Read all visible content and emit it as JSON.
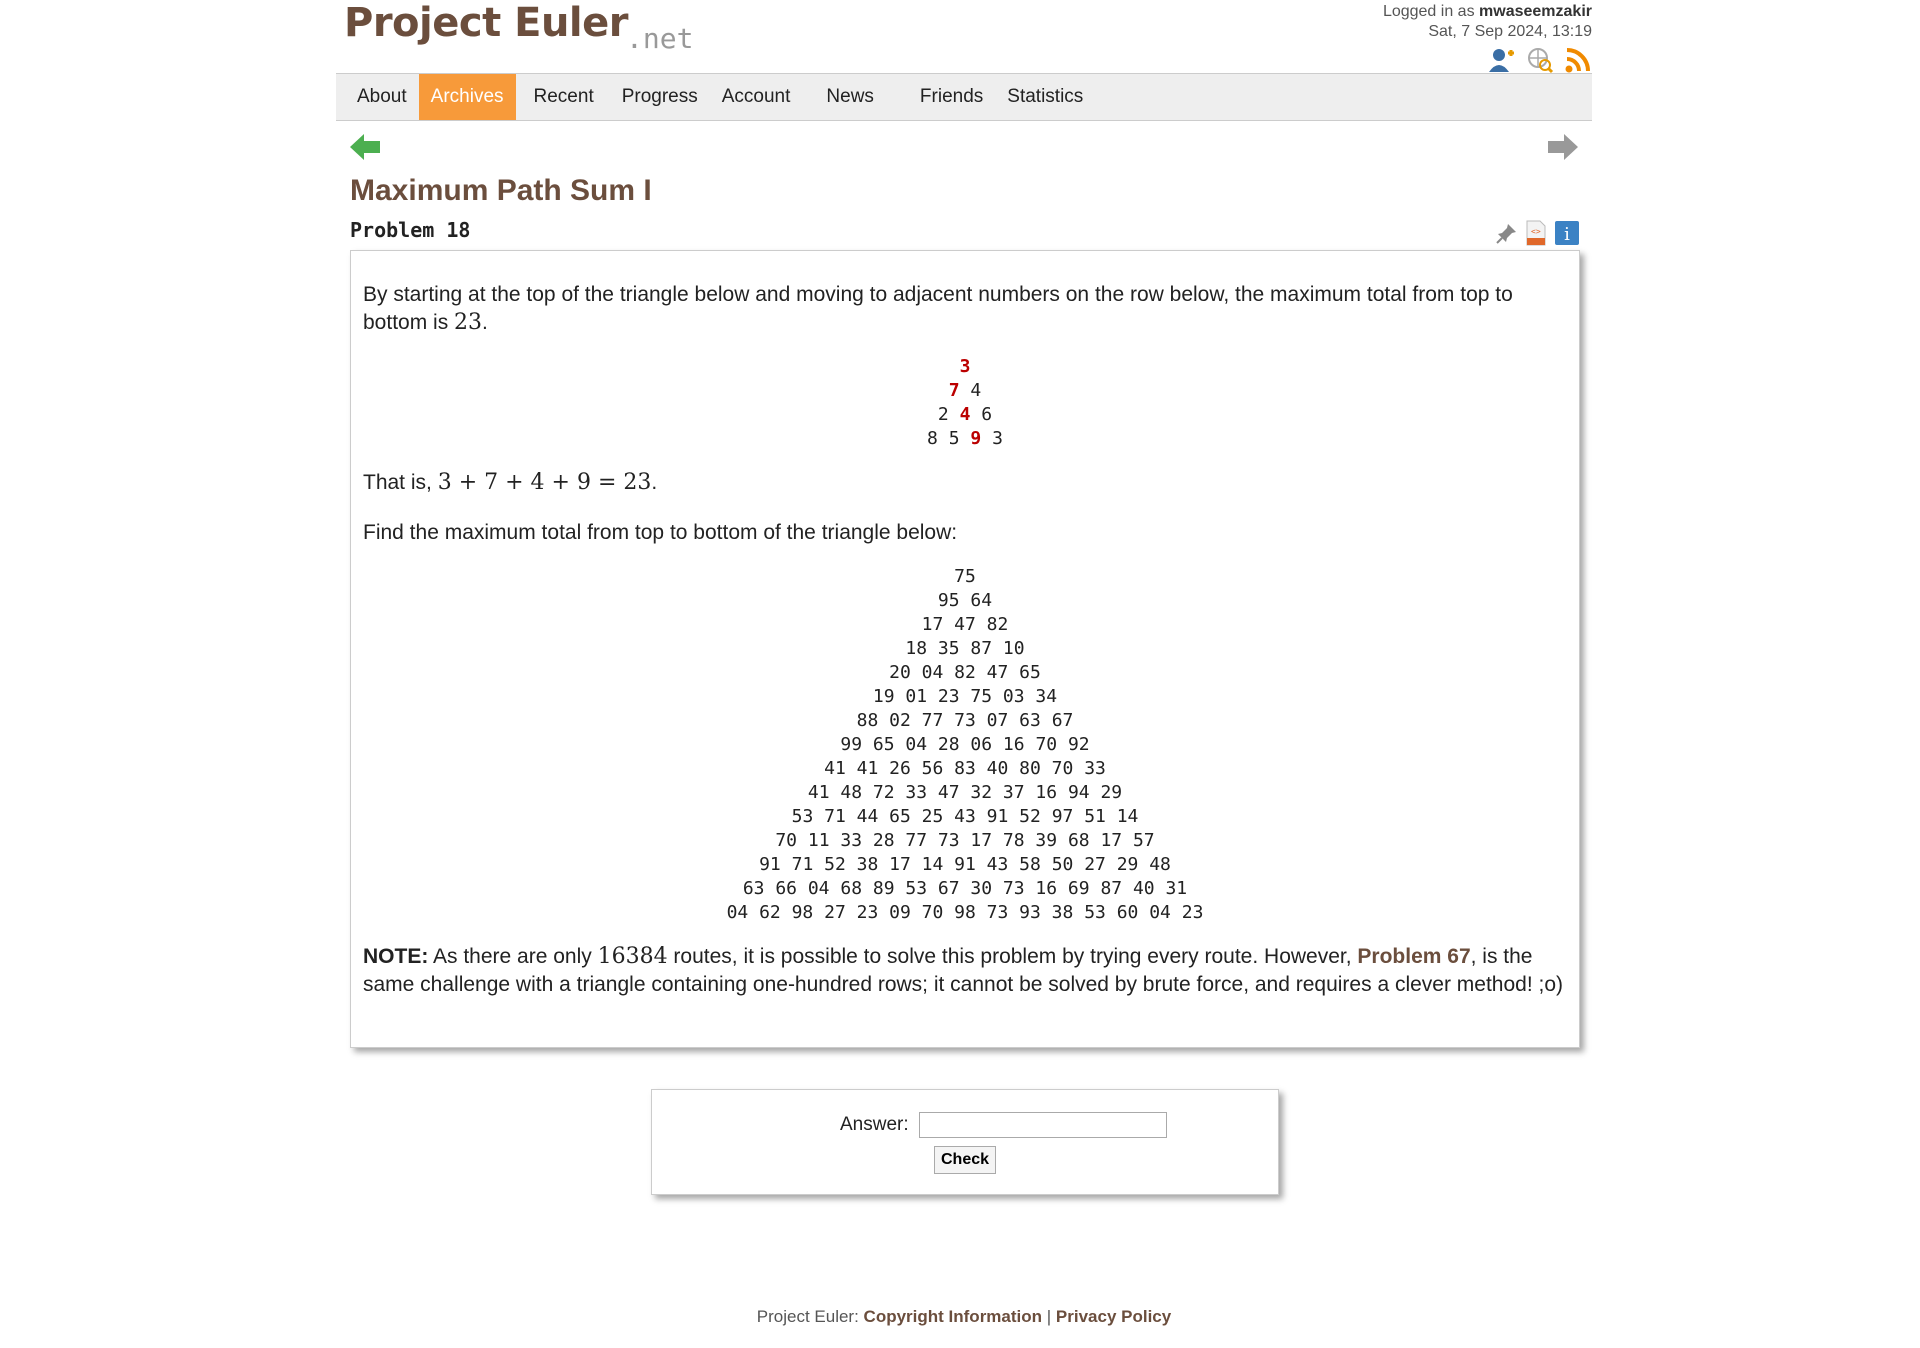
{
  "logo": {
    "main": "Project Euler",
    "suffix": ".net"
  },
  "user": {
    "prefix": "Logged in as",
    "name": "mwaseemzakir",
    "datetime": "Sat, 7 Sep 2024, 13:19"
  },
  "nav": [
    "About",
    "Archives",
    "Recent",
    "Progress",
    "Account",
    "News",
    "Friends",
    "Statistics"
  ],
  "problem": {
    "title": "Maximum Path Sum I",
    "number": "Problem 18",
    "intro_a": "By starting at the top of the triangle below and moving to adjacent numbers on the row below, the maximum total from top to bottom is ",
    "intro_num": "23",
    "intro_b": ".",
    "that_is_a": "That is, ",
    "that_is_math": "3 + 7 + 4 + 9 = 23",
    "that_is_b": ".",
    "find": "Find the maximum total from top to bottom of the triangle below:",
    "note_label": "NOTE:",
    "note_a": " As there are only ",
    "note_num": "16384",
    "note_b": " routes, it is possible to solve this problem by trying every route. However, ",
    "note_link": "Problem 67",
    "note_c": ", is the same challenge with a triangle containing one-hundred rows; it cannot be solved by brute force, and requires a clever method! ;o)"
  },
  "small_triangle": [
    [
      "3"
    ],
    [
      "7",
      "4"
    ],
    [
      "2",
      "4",
      "6"
    ],
    [
      "8",
      "5",
      "9",
      "3"
    ]
  ],
  "small_highlight": [
    0,
    0,
    1,
    2
  ],
  "big_triangle": [
    "75",
    "95 64",
    "17 47 82",
    "18 35 87 10",
    "20 04 82 47 65",
    "19 01 23 75 03 34",
    "88 02 77 73 07 63 67",
    "99 65 04 28 06 16 70 92",
    "41 41 26 56 83 40 80 70 33",
    "41 48 72 33 47 32 37 16 94 29",
    "53 71 44 65 25 43 91 52 97 51 14",
    "70 11 33 28 77 73 17 78 39 68 17 57",
    "91 71 52 38 17 14 91 43 58 50 27 29 48",
    "63 66 04 68 89 53 67 30 73 16 69 87 40 31",
    "04 62 98 27 23 09 70 98 73 93 38 53 60 04 23"
  ],
  "answer": {
    "label": "Answer:",
    "button": "Check"
  },
  "footer": {
    "prefix": "Project Euler:",
    "copyright": "Copyright Information",
    "sep": "|",
    "privacy": "Privacy Policy"
  },
  "colors": {
    "brand": "#6b4e3d",
    "active_tab": "#f79a3a",
    "highlight": "#b00000",
    "nav_prev": "#4caf50",
    "nav_next": "#999999"
  }
}
